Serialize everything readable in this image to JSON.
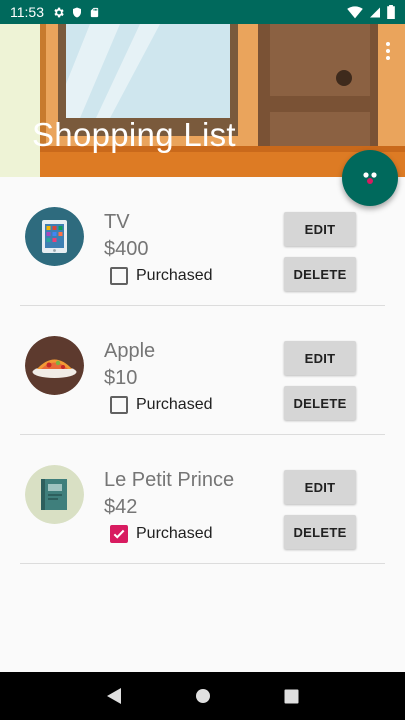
{
  "status_bar": {
    "time": "11:53"
  },
  "header": {
    "title": "Shopping List"
  },
  "items": [
    {
      "name": "TV",
      "price": "$400",
      "purchased_label": "Purchased",
      "purchased": false,
      "edit_label": "EDIT",
      "delete_label": "DELETE",
      "icon": "tablet-icon"
    },
    {
      "name": "Apple",
      "price": "$10",
      "purchased_label": "Purchased",
      "purchased": false,
      "edit_label": "EDIT",
      "delete_label": "DELETE",
      "icon": "food-plate-icon"
    },
    {
      "name": "Le Petit Prince",
      "price": "$42",
      "purchased_label": "Purchased",
      "purchased": true,
      "edit_label": "EDIT",
      "delete_label": "DELETE",
      "icon": "book-icon"
    }
  ],
  "colors": {
    "primary_dark": "#00695c",
    "accent": "#d81b60",
    "button_bg": "#d6d6d6"
  }
}
